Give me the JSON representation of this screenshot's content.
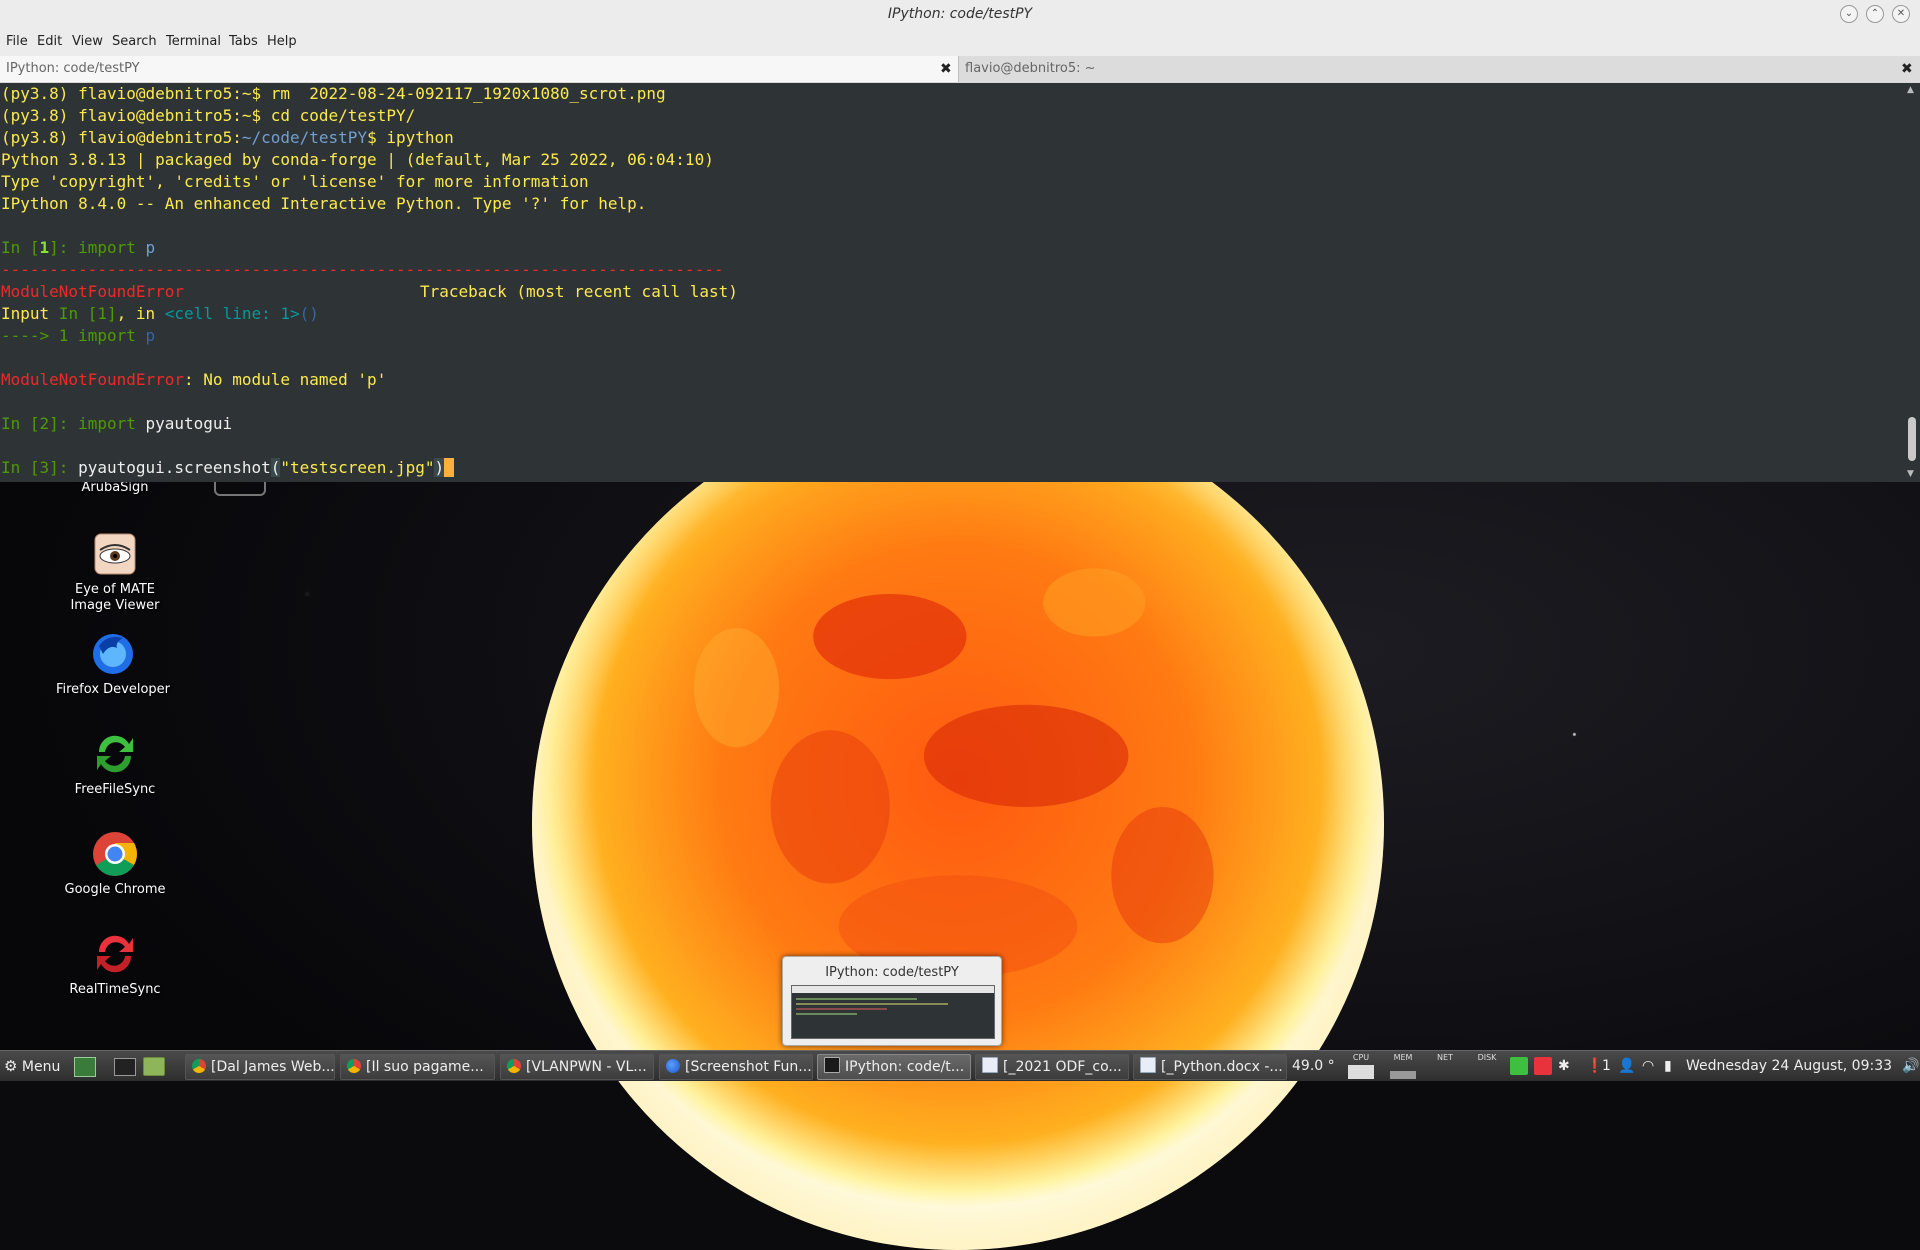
{
  "window": {
    "title": "IPython: code/testPY",
    "controls": [
      "minimize",
      "maximize",
      "close"
    ]
  },
  "menubar": [
    "File",
    "Edit",
    "View",
    "Search",
    "Terminal",
    "Tabs",
    "Help"
  ],
  "tabs": [
    {
      "label": "IPython: code/testPY",
      "active": true,
      "close": "✖"
    },
    {
      "label": "flavio@debnitro5: ~",
      "active": false,
      "close": "✖"
    }
  ],
  "terminal": {
    "prompt_env": "(py3.8)",
    "prompt_user": "flavio@debnitro5",
    "line1_path": ":~$",
    "line1_cmd": " rm  2022-08-24-092117_1920x1080_scrot.png",
    "line2_path": ":~$",
    "line2_cmd": " cd code/testPY/",
    "line3_path_sep": ":",
    "line3_path": "~/code/testPY",
    "line3_dollar": "$",
    "line3_cmd": " ipython",
    "banner1": "Python 3.8.13 | packaged by conda-forge | (default, Mar 25 2022, 06:04:10)",
    "banner2": "Type 'copyright', 'credits' or 'license' for more information",
    "banner3": "IPython 8.4.0 -- An enhanced Interactive Python. Type '?' for help.",
    "in1_prompt_a": "In [",
    "in1_num": "1",
    "in1_prompt_b": "]: ",
    "in1_kw": "import",
    "in1_mod": " p",
    "rule": "---------------------------------------------------------------------------",
    "err_name": "ModuleNotFoundError",
    "traceback_hdr": "Traceback (most recent call last)",
    "input_word": "Input",
    "input_in": " In [1]",
    "input_comma": ", in ",
    "input_cell": "<cell line: 1>",
    "input_parens": "()",
    "arrow": "----> 1 ",
    "arrow_kw": "import",
    "arrow_mod": " p",
    "err2_name": "ModuleNotFoundError",
    "err2_msg": ": No module named 'p'",
    "in2_prompt": "In [2]: ",
    "in2_kw": "import",
    "in2_mod": " pyautogui",
    "in3_prompt": "In [3]: ",
    "in3_call": "pyautogui.screenshot",
    "in3_open": "(",
    "in3_arg": "\"testscreen.jpg\"",
    "in3_close": ")"
  },
  "desktop_icons": [
    {
      "label": "ArubaSign"
    },
    {
      "label": "Eye of MATE Image Viewer"
    },
    {
      "label": "Firefox Developer"
    },
    {
      "label": "FreeFileSync"
    },
    {
      "label": "Google Chrome"
    },
    {
      "label": "RealTimeSync"
    }
  ],
  "preview": {
    "title": "IPython: code/testPY"
  },
  "taskbar": {
    "menu_label": "Menu",
    "tasks": [
      {
        "label": "[Dal James Web...",
        "icon": "chrome-icon"
      },
      {
        "label": "[Il suo pagame...",
        "icon": "chrome-icon"
      },
      {
        "label": "[VLANPWN - VL...",
        "icon": "chrome-icon"
      },
      {
        "label": "[Screenshot Fun...",
        "icon": "firefox-icon"
      },
      {
        "label": "IPython: code/t...",
        "icon": "terminal-icon",
        "active": true
      },
      {
        "label": "[_2021 ODF_co...",
        "icon": "document-icon"
      },
      {
        "label": "[_Python.docx -...",
        "icon": "document-icon"
      }
    ],
    "temperature": "49.0 °",
    "monitors": [
      "CPU",
      "MEM",
      "NET",
      "DISK"
    ],
    "notif_count": "1",
    "clock": "Wednesday 24 August, 09:33"
  },
  "colors": {
    "terminal_bg": "#2e3436",
    "prompt_green": "#8ae234",
    "path_blue": "#729fcf",
    "error_red": "#ef2929",
    "banner_yellow": "#fce94f",
    "cursor": "#fcaf3e"
  }
}
